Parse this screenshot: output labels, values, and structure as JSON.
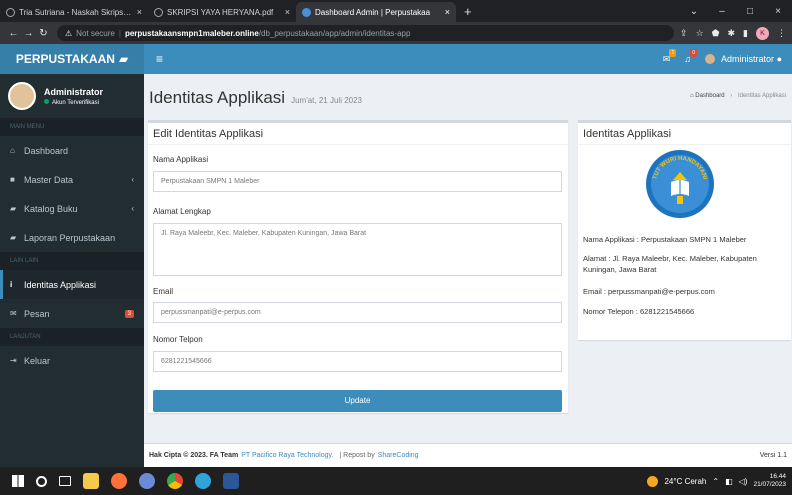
{
  "browser": {
    "tabs": [
      {
        "label": "Tria Sutriana - Naskah Skripsi Ful",
        "close": "×",
        "active": false
      },
      {
        "label": "SKRIPSI YAYA HERYANA.pdf",
        "close": "×",
        "active": false
      },
      {
        "label": "Dashboard Admin | Perpustakaa",
        "close": "×",
        "active": true
      }
    ],
    "new_tab": "+",
    "window_controls": [
      "⌄",
      "–",
      "□",
      "×"
    ],
    "not_secure": "Not secure",
    "url_host": "perpustakaansmpn1maleber.online",
    "url_path": "/db_perpustakaan/app/admin/identitas-app",
    "profile_initial": "K"
  },
  "header": {
    "brand": "PERPUSTAKAAN",
    "mail_count": "1",
    "notif_count": "0",
    "user": "Administrator"
  },
  "sidebar": {
    "user_name": "Administrator",
    "user_status": "Akun Terverifikasi",
    "section_main": "MAIN MENU",
    "items_main": [
      {
        "label": "Dashboard",
        "icon": "home-icon",
        "arrow": ""
      },
      {
        "label": "Master Data",
        "icon": "folder-icon",
        "arrow": "‹"
      },
      {
        "label": "Katalog Buku",
        "icon": "book-icon",
        "arrow": "‹"
      },
      {
        "label": "Laporan Perpustakaan",
        "icon": "book-icon",
        "arrow": ""
      }
    ],
    "section_other": "LAIN LAIN",
    "items_other": [
      {
        "label": "Identitas Applikasi",
        "icon": "info-icon"
      },
      {
        "label": "Pesan",
        "icon": "envelope-icon",
        "count": "3"
      }
    ],
    "section_logout": "LANJUTAN",
    "logout": "Keluar"
  },
  "page": {
    "title": "Identitas Applikasi",
    "date": "Jum'at, 21 Juli 2023",
    "breadcrumb_home": "Dashboard",
    "breadcrumb_current": "Identitas Applikasi"
  },
  "form": {
    "title": "Edit Identitas Applikasi",
    "name_label": "Nama Applikasi",
    "name_value": "Perpustakaan SMPN 1 Maleber",
    "address_label": "Alamat Lengkap",
    "address_value": "Jl. Raya Maleebr, Kec. Maleber, Kabupaten Kuningan, Jawa Barat",
    "email_label": "Email",
    "email_value": "perpussmanpati@e-perpus.com",
    "phone_label": "Nomor Telpon",
    "phone_value": "6281221545666",
    "submit": "Update"
  },
  "identity": {
    "title": "Identitas Applikasi",
    "logo_text": "TUT WURI HANDAYANI",
    "name_line": "Nama Applikasi : Perpustakaan SMPN 1 Maleber",
    "address_line": "Alamat : Jl. Raya Maleebr, Kec. Maleber, Kabupaten Kuningan, Jawa Barat",
    "email_line": "Email : perpussmanpati@e-perpus.com",
    "phone_line": "Nomor Telepon : 6281221545666"
  },
  "footer": {
    "copyright": "Hak Cipta © 2023. FA Team",
    "company": "PT Pacifico Raya Technology.",
    "repost": "| Repost by",
    "repost_link": "ShareCoding",
    "version": "Versi 1.1"
  },
  "taskbar": {
    "weather": "24°C Cerah",
    "time": "16.44",
    "date": "21/07/2023"
  },
  "colors": {
    "primary": "#3c8dbc",
    "brand_dark": "#367fa9",
    "sidebar": "#222d32",
    "danger": "#dd4b39"
  }
}
